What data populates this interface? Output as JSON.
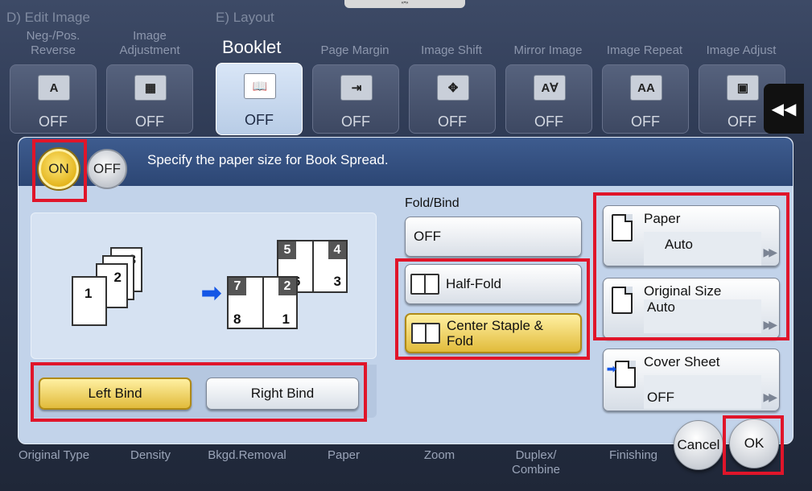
{
  "header": {
    "section_d": "D)  Edit Image",
    "section_e": "E)  Layout",
    "booklet_tab": "Booklet"
  },
  "functions": [
    {
      "label": "Neg-/Pos.\nReverse",
      "icon": "A",
      "status": "OFF"
    },
    {
      "label": "Image\nAdjustment",
      "icon": "▦",
      "status": "OFF"
    },
    {
      "label": "",
      "icon": "📖",
      "status": "OFF"
    },
    {
      "label": "Page Margin",
      "icon": "⇥",
      "status": "OFF"
    },
    {
      "label": "Image Shift",
      "icon": "✥",
      "status": "OFF"
    },
    {
      "label": "Mirror Image",
      "icon": "A∀",
      "status": "OFF"
    },
    {
      "label": "Image Repeat",
      "icon": "AA",
      "status": "OFF"
    },
    {
      "label": "Image Adjust",
      "icon": "▣",
      "status": "OFF"
    }
  ],
  "collapse_icon": "◀◀",
  "bottom_labels": [
    "Original Type",
    "Density",
    "Bkgd.Removal",
    "Paper",
    "Zoom",
    "Duplex/\nCombine",
    "Finishing"
  ],
  "dialog": {
    "on_label": "ON",
    "off_label": "OFF",
    "message": "Specify the paper size for Book Spread.",
    "left_bind": "Left Bind",
    "right_bind": "Right Bind",
    "fold_title": "Fold/Bind",
    "fold_off": "OFF",
    "half_fold": "Half-Fold",
    "center_staple": "Center Staple &\nFold",
    "paper_title": "Paper",
    "paper_value": "Auto",
    "original_size_title": "Original Size",
    "original_size_value": "Auto",
    "cover_sheet_title": "Cover Sheet",
    "cover_sheet_value": "OFF",
    "cancel_label": "Cancel",
    "ok_label": "OK"
  },
  "illustration": {
    "stack_pages": [
      "1",
      "2",
      "8"
    ],
    "booklet_pages": [
      "5",
      "4",
      "6",
      "3",
      "7",
      "2",
      "8",
      "1"
    ]
  },
  "colors": {
    "highlight": "#e0152a",
    "selected_gold": "#e1bb3b",
    "dialog_bg": "#c2d3ea"
  }
}
